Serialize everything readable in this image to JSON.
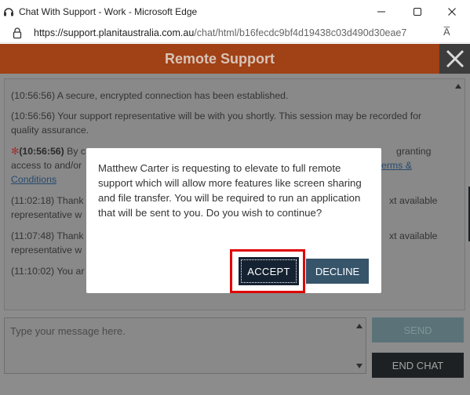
{
  "window": {
    "title": "Chat With Support - Work - Microsoft Edge",
    "minimize_glyph": "—",
    "maximize_glyph": "☐",
    "close_glyph": "✕"
  },
  "address_bar": {
    "url_scheme_host": "https://support.planitaustralia.com.au",
    "url_path": "/chat/html/b16fecdc9bf4d19438c03d490d30eae7",
    "read_aloud_label": "A̅"
  },
  "header": {
    "title": "Remote Support"
  },
  "transcript": {
    "messages": [
      {
        "time": "(10:56:56)",
        "text": " A secure, encrypted connection has been established."
      },
      {
        "time": "(10:56:56)",
        "text": " Your support representative will be with you shortly. This session may be recorded for quality assurance."
      },
      {
        "star": "✻",
        "time": "(10:56:56)",
        "text_a": " By c",
        "text_b": "granting",
        "text_c": "access to and/or",
        "link_a": "erms &",
        "link_b": "Conditions"
      },
      {
        "time": "(11:02:18)",
        "text": " Thank",
        "tail": "xt available",
        "line2": "representative w"
      },
      {
        "time": "(11:07:48)",
        "text": " Thank",
        "tail": "xt available",
        "line2": "representative w"
      },
      {
        "time": "(11:10:02)",
        "text": " You ar"
      }
    ]
  },
  "composer": {
    "placeholder": "Type your message here."
  },
  "buttons": {
    "send": "SEND",
    "end_chat": "END CHAT"
  },
  "modal": {
    "message": "Matthew Carter is requesting to elevate to full remote support which will allow more features like screen sharing and file transfer. You will be required to run an application that will be sent to you. Do you wish to continue?",
    "accept": "ACCEPT",
    "decline": "DECLINE"
  },
  "colors": {
    "header_bg": "#a04116",
    "accept_bg": "#152231",
    "decline_bg": "#36546a",
    "highlight": "#e00000"
  }
}
